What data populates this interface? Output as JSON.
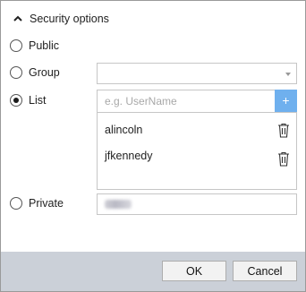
{
  "section": {
    "title": "Security options",
    "icon": "chevron-up-icon"
  },
  "options": {
    "public": {
      "label": "Public",
      "checked": false
    },
    "group": {
      "label": "Group",
      "checked": false,
      "value": ""
    },
    "list": {
      "label": "List",
      "checked": true,
      "placeholder": "e.g. UserName",
      "add_label": "+"
    },
    "private": {
      "label": "Private",
      "checked": false
    }
  },
  "list_items": [
    "alincoln",
    "jfkennedy"
  ],
  "buttons": {
    "ok": "OK",
    "cancel": "Cancel"
  },
  "colors": {
    "accent": "#6fb0ee",
    "footer": "#cbd0d8"
  }
}
